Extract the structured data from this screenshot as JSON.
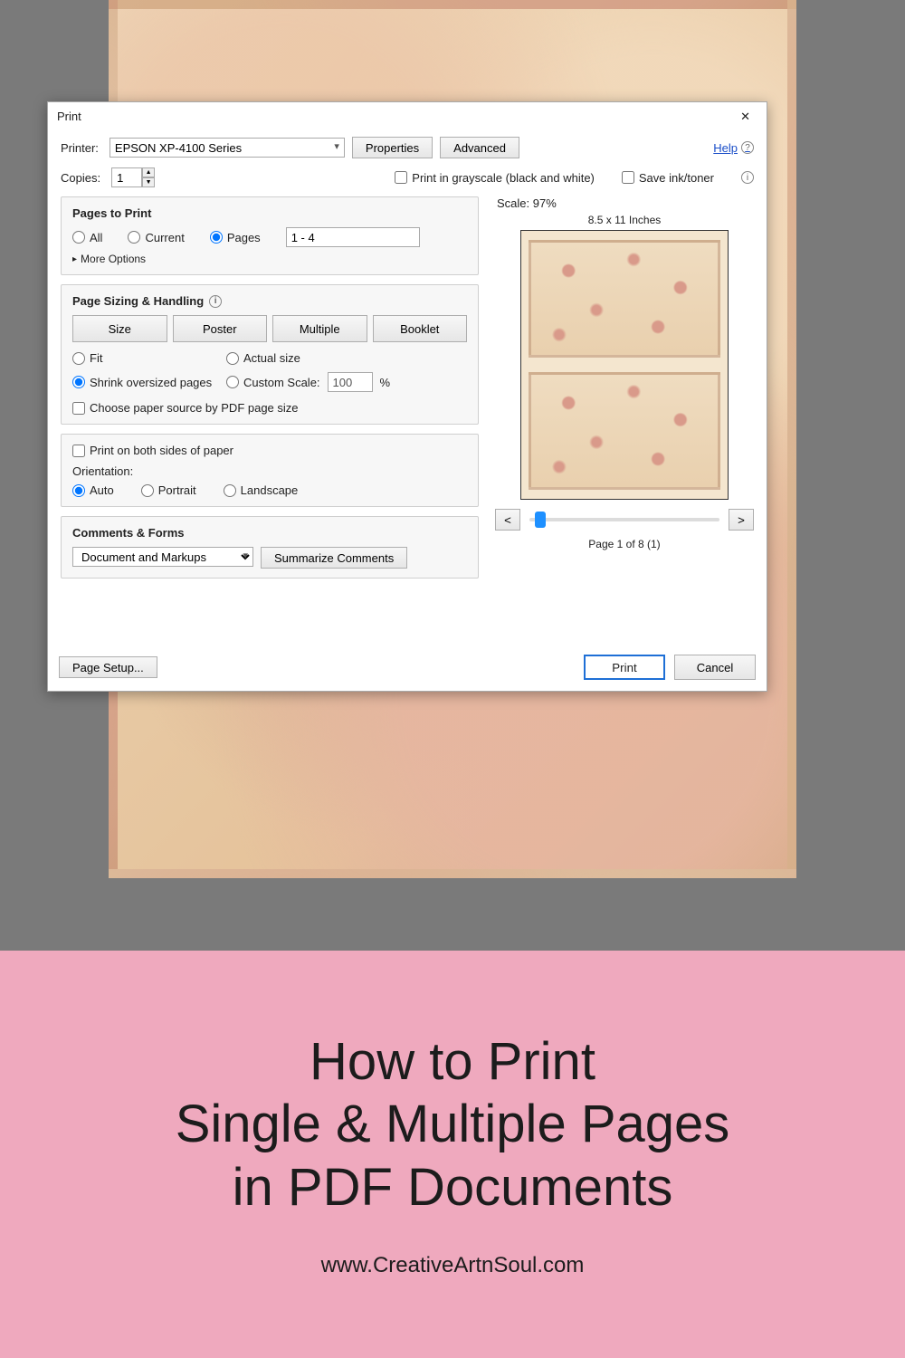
{
  "dialog": {
    "title": "Print",
    "printer_label": "Printer:",
    "printer_selected": "EPSON XP-4100 Series",
    "properties_btn": "Properties",
    "advanced_btn": "Advanced",
    "help": "Help",
    "copies_label": "Copies:",
    "copies_value": "1",
    "grayscale": "Print in grayscale (black and white)",
    "save_ink": "Save ink/toner"
  },
  "pages_section": {
    "title": "Pages to Print",
    "all": "All",
    "current": "Current",
    "pages": "Pages",
    "range_value": "1 - 4",
    "more": "More Options"
  },
  "sizing": {
    "title": "Page Sizing & Handling",
    "tabs": {
      "size": "Size",
      "poster": "Poster",
      "multiple": "Multiple",
      "booklet": "Booklet"
    },
    "fit": "Fit",
    "actual": "Actual size",
    "shrink": "Shrink oversized pages",
    "custom": "Custom Scale:",
    "custom_value": "100",
    "percent": "%",
    "paper_source": "Choose paper source by PDF page size"
  },
  "duplex": {
    "both_sides": "Print on both sides of paper",
    "orientation_label": "Orientation:",
    "auto": "Auto",
    "portrait": "Portrait",
    "landscape": "Landscape"
  },
  "comments": {
    "title": "Comments & Forms",
    "selected": "Document and Markups",
    "summarize_btn": "Summarize Comments"
  },
  "preview": {
    "scale": "Scale:  97%",
    "paper": "8.5 x 11 Inches",
    "prev": "<",
    "next": ">",
    "page_of": "Page 1 of 8 (1)"
  },
  "footer": {
    "page_setup": "Page Setup...",
    "print": "Print",
    "cancel": "Cancel"
  },
  "banner": {
    "line1": "How to Print",
    "line2": "Single & Multiple Pages",
    "line3": "in PDF Documents",
    "url": "www.CreativeArtnSoul.com"
  }
}
